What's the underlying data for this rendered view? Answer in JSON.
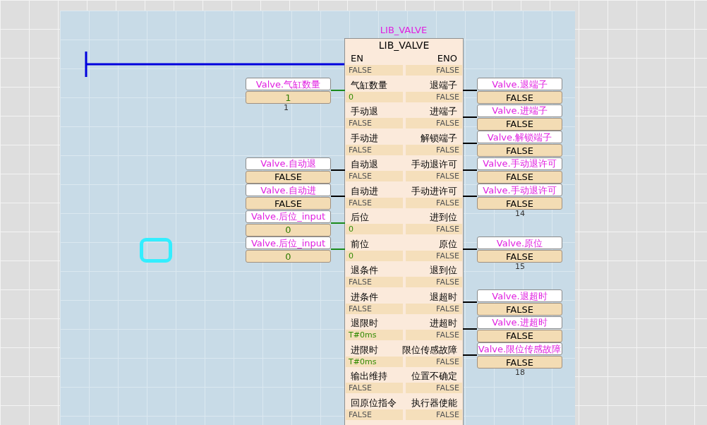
{
  "block": {
    "instance": "LIB_VALVE",
    "type": "LIB_VALVE",
    "pins": [
      {
        "input": "EN",
        "input_value": "FALSE",
        "input_constant": false,
        "output": "ENO",
        "output_value": "FALSE",
        "power_rail": true
      },
      {
        "input": "气缸数量",
        "input_value": "0",
        "input_constant": true,
        "output": "退端子",
        "output_value": "FALSE",
        "input_variable": {
          "name": "Valve.气缸数量",
          "value": "1",
          "kind": "int",
          "number": "1"
        },
        "output_variable": {
          "name": "Valve.退端子",
          "value": "FALSE",
          "kind": "bool"
        }
      },
      {
        "input": "手动退",
        "input_value": "FALSE",
        "input_constant": false,
        "output": "进端子",
        "output_value": "FALSE",
        "output_variable": {
          "name": "Valve.进端子",
          "value": "FALSE",
          "kind": "bool"
        }
      },
      {
        "input": "手动进",
        "input_value": "FALSE",
        "input_constant": false,
        "output": "解锁端子",
        "output_value": "FALSE",
        "output_variable": {
          "name": "Valve.解锁端子",
          "value": "FALSE",
          "kind": "bool"
        }
      },
      {
        "input": "自动退",
        "input_value": "FALSE",
        "input_constant": false,
        "output": "手动退许可",
        "output_value": "FALSE",
        "input_variable": {
          "name": "Valve.自动退",
          "value": "FALSE",
          "kind": "bool"
        },
        "output_variable": {
          "name": "Valve.手动退许可",
          "value": "FALSE",
          "kind": "bool"
        }
      },
      {
        "input": "自动进",
        "input_value": "FALSE",
        "input_constant": false,
        "output": "手动进许可",
        "output_value": "FALSE",
        "input_variable": {
          "name": "Valve.自动进",
          "value": "FALSE",
          "kind": "bool"
        },
        "output_variable": {
          "name": "Valve.手动退许可",
          "value": "FALSE",
          "kind": "bool",
          "number": "14"
        }
      },
      {
        "input": "后位",
        "input_value": "0",
        "input_constant": true,
        "output": "进到位",
        "output_value": "FALSE",
        "input_variable": {
          "name": "Valve.后位_input",
          "value": "0",
          "kind": "int"
        }
      },
      {
        "input": "前位",
        "input_value": "0",
        "input_constant": true,
        "output": "原位",
        "output_value": "FALSE",
        "input_variable": {
          "name": "Valve.后位_input",
          "value": "0",
          "kind": "int"
        },
        "output_variable": {
          "name": "Valve.原位",
          "value": "FALSE",
          "kind": "bool",
          "number": "15"
        }
      },
      {
        "input": "退条件",
        "input_value": "FALSE",
        "input_constant": false,
        "output": "退到位",
        "output_value": "FALSE"
      },
      {
        "input": "进条件",
        "input_value": "FALSE",
        "input_constant": false,
        "output": "退超时",
        "output_value": "FALSE",
        "output_variable": {
          "name": "Valve.退超时",
          "value": "FALSE",
          "kind": "bool"
        }
      },
      {
        "input": "退限时",
        "input_value": "T#0ms",
        "input_constant": true,
        "output": "进超时",
        "output_value": "FALSE",
        "output_variable": {
          "name": "Valve.进超时",
          "value": "FALSE",
          "kind": "bool"
        }
      },
      {
        "input": "进限时",
        "input_value": "T#0ms",
        "input_constant": true,
        "output": "限位传感故障",
        "output_value": "FALSE",
        "output_variable": {
          "name": "Valve.限位传感故障",
          "value": "FALSE",
          "kind": "bool",
          "number": "18"
        }
      },
      {
        "input": "输出维持",
        "input_value": "FALSE",
        "input_constant": false,
        "output": "位置不确定",
        "output_value": "FALSE"
      },
      {
        "input": "回原位指令",
        "input_value": "FALSE",
        "input_constant": false,
        "output": "执行器使能",
        "output_value": "FALSE"
      }
    ]
  }
}
